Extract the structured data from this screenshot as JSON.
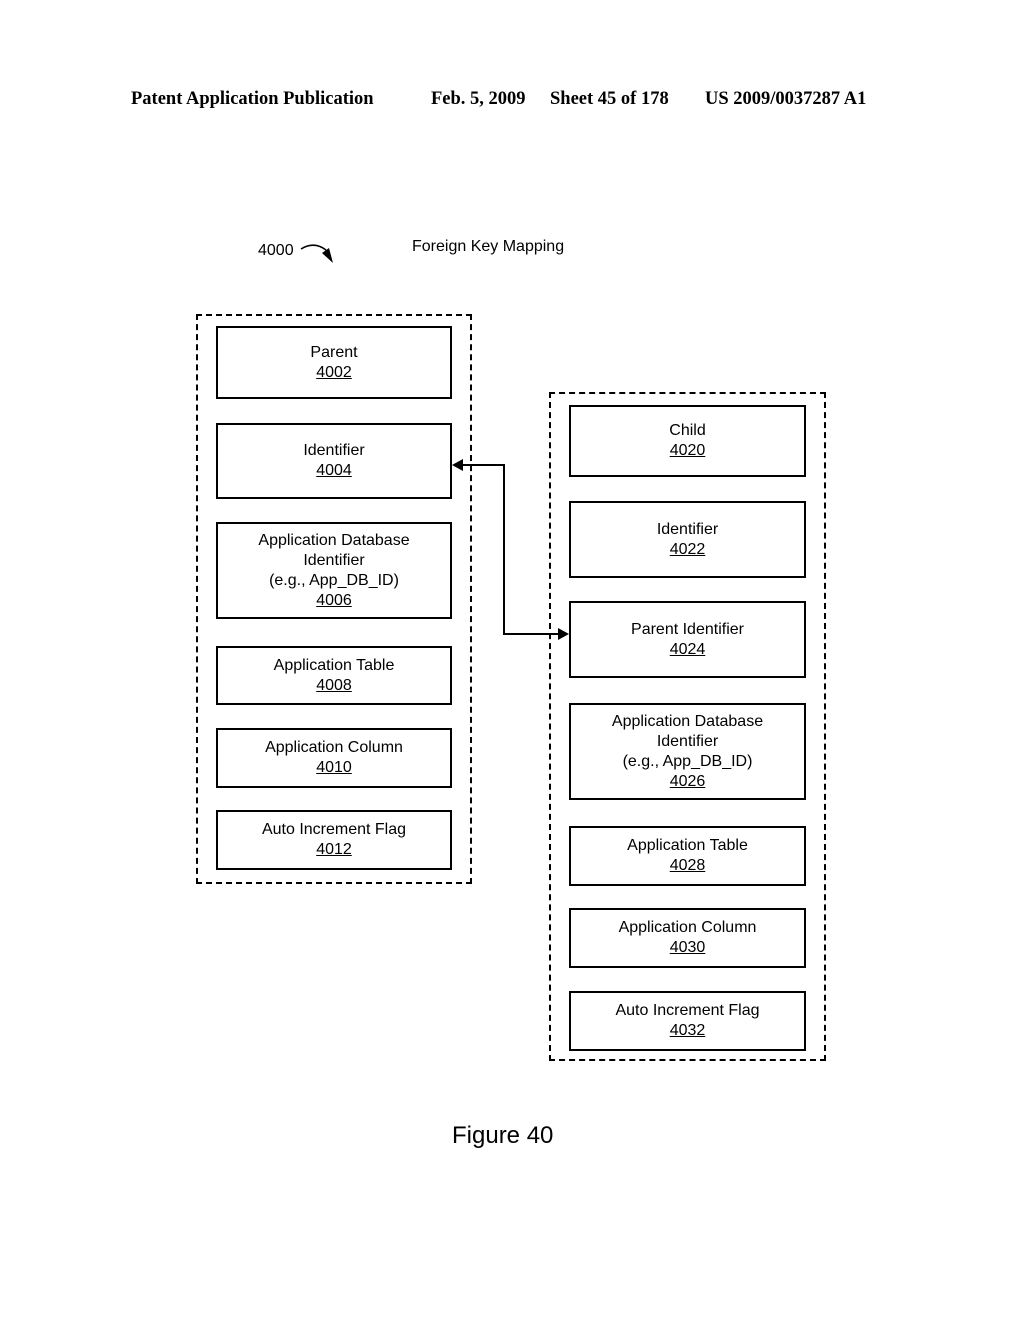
{
  "header": {
    "publication": "Patent Application Publication",
    "date": "Feb. 5, 2009",
    "sheet": "Sheet 45 of 178",
    "patent_number": "US 2009/0037287 A1"
  },
  "diagram": {
    "reference_number": "4000",
    "title": "Foreign Key Mapping",
    "parent_group": {
      "boxes": [
        {
          "lines": [
            "Parent"
          ],
          "number": "4002"
        },
        {
          "lines": [
            "Identifier"
          ],
          "number": "4004"
        },
        {
          "lines": [
            "Application Database",
            "Identifier",
            "(e.g., App_DB_ID)"
          ],
          "number": "4006"
        },
        {
          "lines": [
            "Application Table"
          ],
          "number": "4008"
        },
        {
          "lines": [
            "Application Column"
          ],
          "number": "4010"
        },
        {
          "lines": [
            "Auto Increment Flag"
          ],
          "number": "4012"
        }
      ]
    },
    "child_group": {
      "boxes": [
        {
          "lines": [
            "Child"
          ],
          "number": "4020"
        },
        {
          "lines": [
            "Identifier"
          ],
          "number": "4022"
        },
        {
          "lines": [
            "Parent Identifier"
          ],
          "number": "4024"
        },
        {
          "lines": [
            "Application Database",
            "Identifier",
            "(e.g., App_DB_ID)"
          ],
          "number": "4026"
        },
        {
          "lines": [
            "Application Table"
          ],
          "number": "4028"
        },
        {
          "lines": [
            "Application Column"
          ],
          "number": "4030"
        },
        {
          "lines": [
            "Auto Increment Flag"
          ],
          "number": "4032"
        }
      ]
    },
    "connections": [
      {
        "from": "4024",
        "to": "4004",
        "type": "bidirectional-arrow"
      }
    ]
  },
  "figure_label": "Figure 40"
}
